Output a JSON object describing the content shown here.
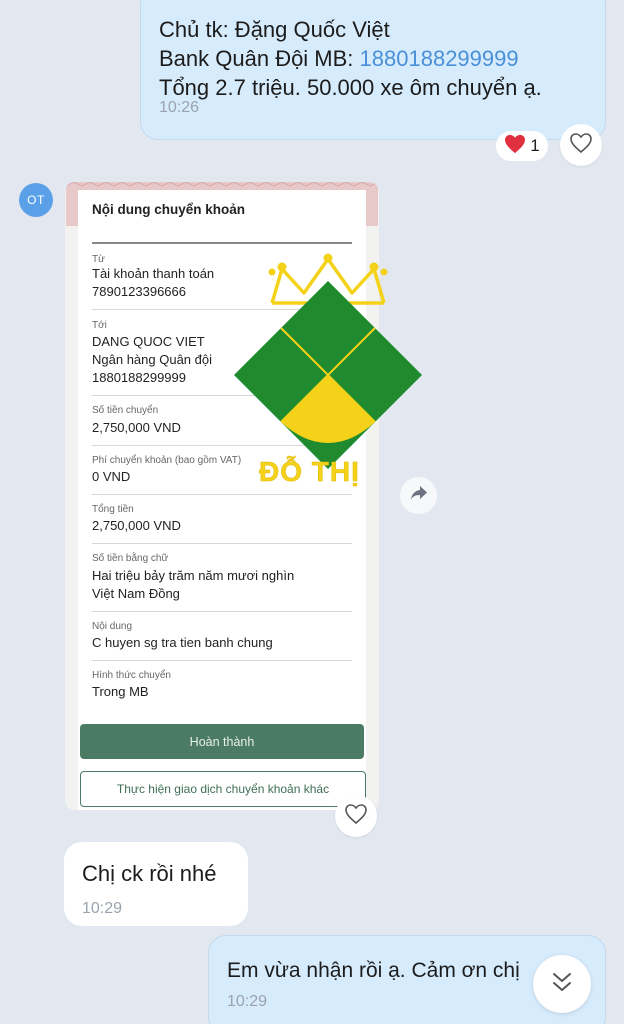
{
  "messages": {
    "outgoing_1": {
      "line1": "Chủ tk: Đặng Quốc Việt",
      "line2_prefix": "Bank Quân Đội MB: ",
      "account_link": "1880188299999",
      "line3": "Tổng 2.7 triệu. 50.000 xe ôm chuyển ạ.",
      "time": "10:26",
      "reaction_count": "1"
    },
    "incoming_image": {
      "avatar_initials": "OT",
      "receipt": {
        "header": "Nội dung chuyển khoản",
        "from_label": "Từ",
        "from_account_type": "Tài khoản thanh toán",
        "from_account_number": "7890123396666",
        "to_label": "Tới",
        "to_name": "DANG QUOC VIET",
        "to_bank": "Ngân hàng Quân đội",
        "to_account_number": "1880188299999",
        "amount_label": "Số tiền chuyển",
        "amount": "2,750,000 VND",
        "fee_label": "Phí chuyển khoản (bao gồm VAT)",
        "fee": "0 VND",
        "total_label": "Tổng tiền",
        "total": "2,750,000 VND",
        "amount_words_label": "Số tiền bằng chữ",
        "amount_words_line1": "Hai triệu bảy trăm năm mươi nghìn",
        "amount_words_line2": "Việt Nam Đồng",
        "content_label": "Nội dung",
        "content": "C huyen sg tra tien banh chung",
        "method_label": "Hình thức chuyển",
        "method": "Trong MB",
        "done_button": "Hoàn thành",
        "other_transfer_button": "Thực hiện giao dịch chuyển khoản khác"
      },
      "watermark_text": "ĐỖ THỊ"
    },
    "incoming_2": {
      "text": "Chị ck rồi nhé",
      "time": "10:29"
    },
    "outgoing_2": {
      "text": "Em vừa nhận rồi ạ. Cảm ơn chị",
      "time": "10:29"
    }
  },
  "colors": {
    "outgoing_bubble": "#d6ebfc",
    "incoming_bubble": "#ffffff",
    "background": "#e3e8f0",
    "link": "#4a90d9",
    "receipt_green": "#4c7b64",
    "watermark_green": "#1f8a2e",
    "watermark_yellow": "#f5d21a"
  },
  "icons": {
    "reaction": "red-heart-icon",
    "like": "heart-outline-icon",
    "share": "share-arrow-icon",
    "scroll": "double-chevron-down-icon",
    "watermark": "crown-diamond-logo"
  }
}
